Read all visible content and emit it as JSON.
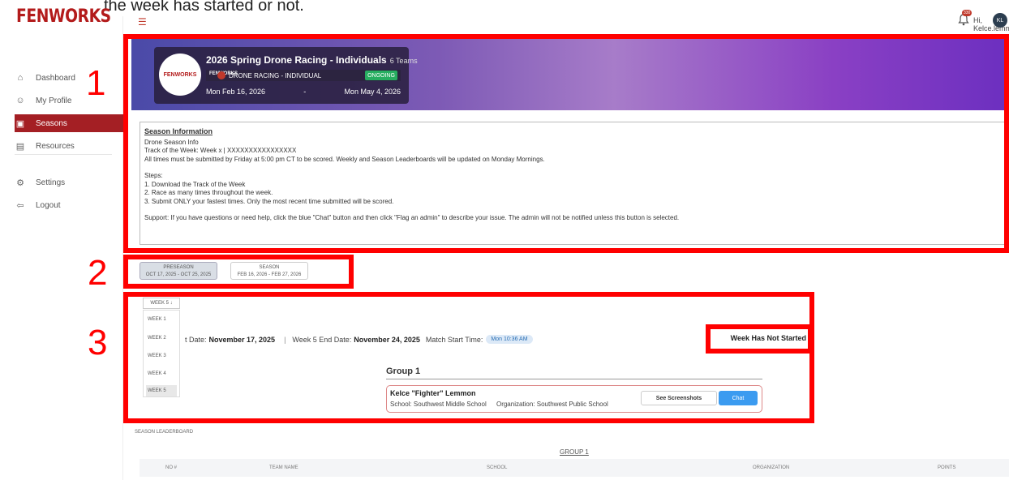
{
  "caption_text": "the week has started or not.",
  "app": {
    "logo_text": "FENWORKS"
  },
  "sidebar": {
    "items": [
      {
        "label": "Dashboard",
        "icon": "home-icon"
      },
      {
        "label": "My Profile",
        "icon": "user-icon"
      },
      {
        "label": "Seasons",
        "icon": "seasons-icon",
        "active": true
      },
      {
        "label": "Resources",
        "icon": "document-icon"
      },
      {
        "label": "Settings",
        "icon": "gear-icon"
      },
      {
        "label": "Logout",
        "icon": "logout-icon"
      }
    ]
  },
  "header": {
    "notifications_count": "330",
    "greeting": "Hi, Kelce.lemmon",
    "avatar_initials": "KL"
  },
  "annotations": {
    "n1": "1",
    "n2": "2",
    "n3": "3"
  },
  "banner": {
    "title": "2026 Spring Drone Racing - Individuals",
    "teams": "6 Teams",
    "logo_text": "FENWORKS",
    "category": "DRONE RACING - INDIVIDUAL",
    "status": "ONGOING",
    "start_date": "Mon Feb 16, 2026",
    "separator": "-",
    "end_date": "Mon May 4, 2026"
  },
  "season_info": {
    "heading": "Season Information",
    "line1": "Drone Season Info",
    "line2": "Track of the Week: Week x  |  XXXXXXXXXXXXXXXX",
    "line3": "All times must be submitted by Friday at 5:00 pm CT to be scored. Weekly and Season Leaderboards will be updated on Monday Mornings.",
    "steps_label": "Steps:",
    "step1": "1. Download the Track of the Week",
    "step2": "2. Race as many times throughout the week.",
    "step3": "3. Submit ONLY your fastest times. Only the most recent time submitted will be scored.",
    "support": "Support: If you have questions or need help, click the blue \"Chat\" button and then click \"Flag an admin\" to describe your issue. The admin will not be notified unless this button is selected."
  },
  "season_tabs": [
    {
      "name": "PRESEASON",
      "dates": "OCT 17, 2025 - OCT 25, 2025",
      "selected": true
    },
    {
      "name": "SEASON",
      "dates": "FEB 16, 2026 - FEB 27, 2026",
      "selected": false
    }
  ],
  "week": {
    "dropdown_label": "WEEK 5 ↓",
    "options": [
      "WEEK 1",
      "WEEK 2",
      "WEEK 3",
      "WEEK 4",
      "WEEK 5"
    ],
    "selected": "WEEK 5",
    "start_prefix": "t Date:",
    "start_date": "November 17, 2025",
    "divider": "|",
    "end_prefix": "Week 5 End Date:",
    "end_date": "November 24, 2025",
    "match_label": "Match Start Time:",
    "match_time": "Mon 10:36 AM",
    "status": "Week Has Not Started"
  },
  "group": {
    "title": "Group 1",
    "team_name": "Kelce \"Fighter\" Lemmon",
    "school": "School: Southwest Middle School",
    "organization": "Organization: Southwest Public School",
    "see_screenshots": "See Screenshots",
    "chat": "Chat"
  },
  "leaderboard": {
    "title": "SEASON LEADERBOARD",
    "group": "GROUP 1",
    "columns": [
      "NO #",
      "TEAM NAME",
      "SCHOOL",
      "ORGANIZATION",
      "POINTS"
    ]
  },
  "colors": {
    "brand": "#a41f24",
    "annotation": "#ff0000",
    "chat": "#3b9bf0",
    "ongoing": "#27ae60"
  }
}
